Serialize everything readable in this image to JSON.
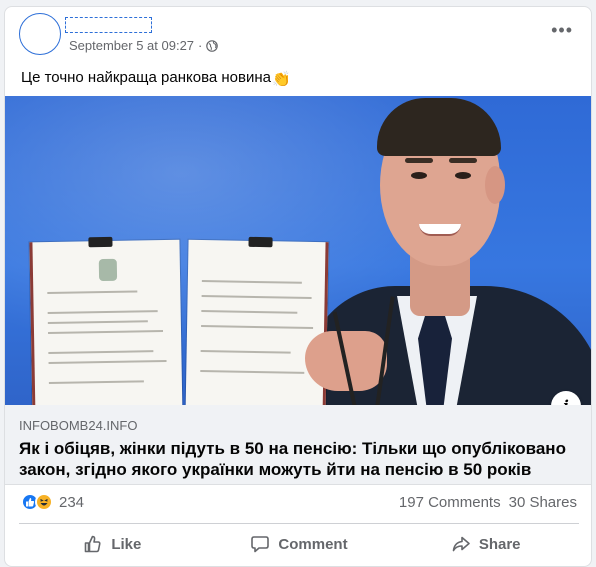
{
  "post": {
    "timestamp": "September 5 at 09:27",
    "text": "Це точно найкраща ранкова новина",
    "emoji": "👏"
  },
  "link": {
    "domain": "INFOBOMB24.INFO",
    "headline": "Як і обіцяв, жінки підуть в 50 на пенсію: Тільки що опубліковано закон, згідно якого українки можуть йти на пенсію в 50 років"
  },
  "stats": {
    "reaction_count": "234",
    "comments": "197 Comments",
    "shares": "30 Shares"
  },
  "actions": {
    "like": "Like",
    "comment": "Comment",
    "share": "Share"
  },
  "colors": {
    "accent": "#1877f2",
    "muted_text": "#65676b",
    "link_bg": "#f0f2f5"
  },
  "icons": [
    "globe-icon",
    "more-options-icon",
    "info-icon",
    "like-reaction-icon",
    "haha-reaction-icon",
    "thumbs-up-icon",
    "comment-icon",
    "share-icon"
  ]
}
